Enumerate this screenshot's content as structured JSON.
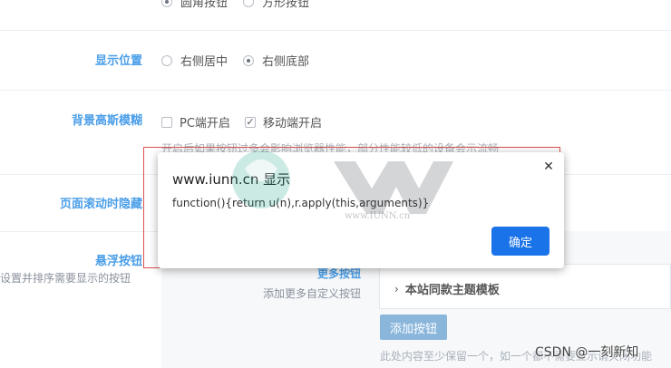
{
  "settings": {
    "row0": {
      "label": "",
      "options": [
        "圆角按钮",
        "方形按钮"
      ],
      "selected": 0
    },
    "position": {
      "label": "显示位置",
      "options": [
        "右侧居中",
        "右侧底部"
      ],
      "selected": 1
    },
    "blur": {
      "label": "背景高斯模糊",
      "options": [
        "PC端开启",
        "移动端开启"
      ],
      "checked": [
        false,
        true
      ],
      "hint": "开启后如果按钮过多会影响浏览器性能，部分性能较低的设备会示流畅"
    },
    "scroll_hide": {
      "label": "页面滚动时隐藏"
    },
    "float_buttons": {
      "label": "悬浮按钮",
      "hint": "设置并排序需要显示的按钮",
      "more_title": "更多按钮",
      "more_hint": "添加更多自定义按钮",
      "template_item": "本站同款主题模板",
      "add_button": "添加按钮",
      "footer_hint": "此处内容至少保留一个，如一个都不需要显示请关闭功能"
    }
  },
  "dialog": {
    "title": "www.iunn.cn 显示",
    "message": "function(){return u(n),r.apply(this,arguments)}",
    "ok_label": "确定"
  },
  "watermark": {
    "site_text": "www.IUNN.cn",
    "csdn_text": "CSDN @一刻新知"
  },
  "colors": {
    "label_blue": "#4a9ee8",
    "ok_blue": "#1a73e8",
    "outline_red": "#d9534f",
    "add_button": "#8ab6dc"
  }
}
